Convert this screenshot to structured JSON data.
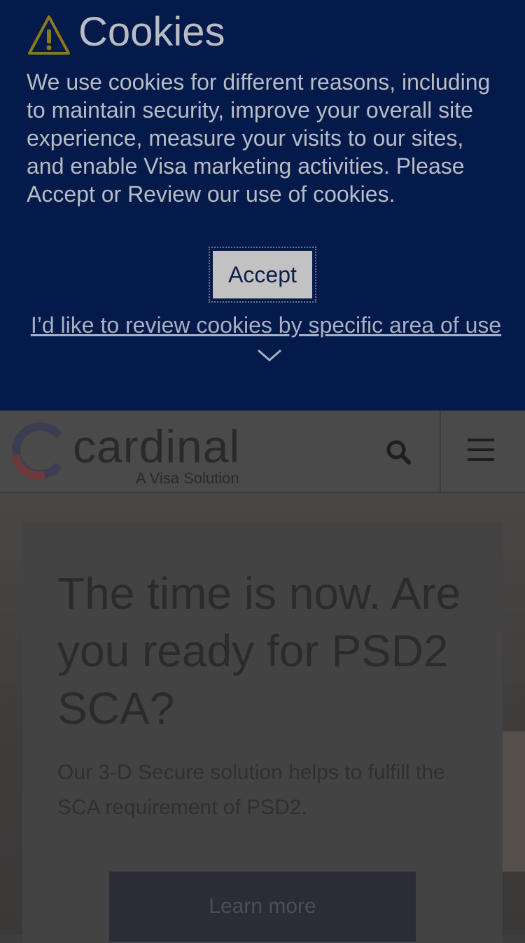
{
  "cookie": {
    "icon": "warning-icon",
    "title": "Cookies",
    "message": "We use cookies for different reasons, including to maintain security, improve your overall site experience, measure your visits to our sites, and enable Visa marketing activities. Please Accept or Review our use of cookies.",
    "accept_label": "Accept",
    "review_label": "I’d like to review cookies by specific area of use",
    "colors": {
      "background": "#041a4a",
      "text": "#b9bcc4"
    }
  },
  "header": {
    "logo_text": "cardinal",
    "logo_sub": "A Visa Solution",
    "search_icon": "search-icon",
    "menu_icon": "hamburger-menu-icon"
  },
  "hero": {
    "title": "The time is now. Are you ready for PSD2 SCA?",
    "subtitle": "Our 3-D Secure solution helps to fulfill the SCA requirement of PSD2.",
    "cta_label": "Learn more"
  }
}
